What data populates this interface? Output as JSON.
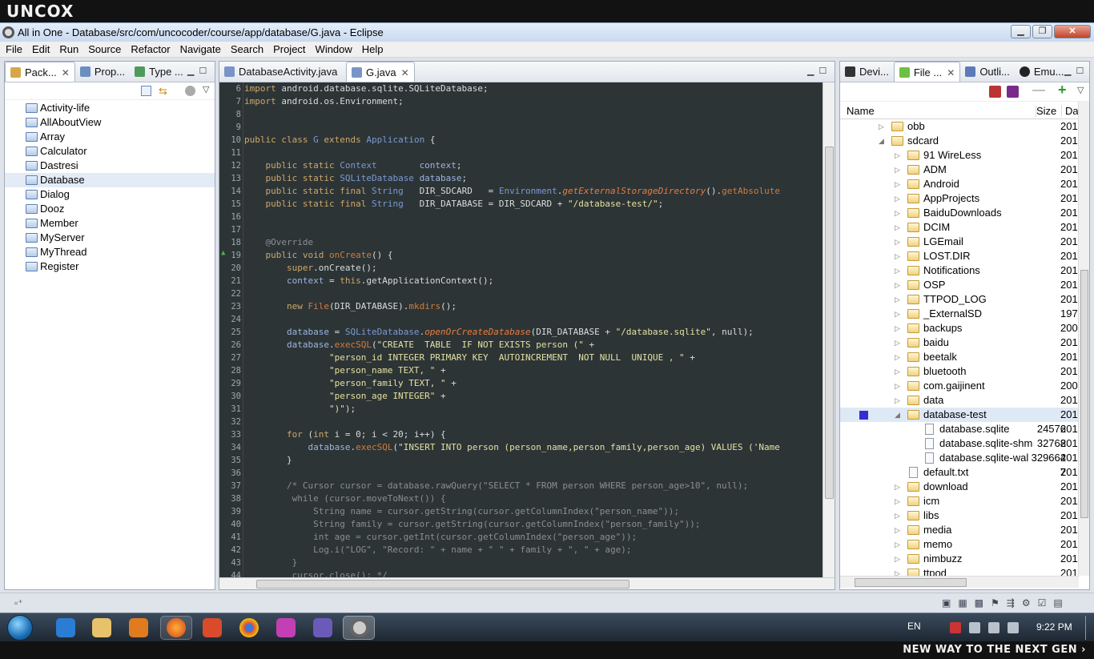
{
  "brand": "UNCOX",
  "tagline": "NEW WAY TO THE NEXT GEN ›",
  "window": {
    "title": "All in One - Database/src/com/uncocoder/course/app/database/G.java - Eclipse"
  },
  "menu": [
    "File",
    "Edit",
    "Run",
    "Source",
    "Refactor",
    "Navigate",
    "Search",
    "Project",
    "Window",
    "Help"
  ],
  "left_tabs": [
    "Pack...",
    "Prop...",
    "Type ..."
  ],
  "projects": [
    "Activity-life",
    "AllAboutView",
    "Array",
    "Calculator",
    "Dastresi",
    "Database",
    "Dialog",
    "Dooz",
    "Member",
    "MyServer",
    "MyThread",
    "Register"
  ],
  "selected_project": "Database",
  "editor_tabs": [
    "DatabaseActivity.java",
    "G.java"
  ],
  "line_numbers": [
    "6",
    "7",
    "8",
    "9",
    "10",
    "11",
    "12",
    "13",
    "14",
    "15",
    "16",
    "17",
    "18",
    "19",
    "20",
    "21",
    "22",
    "23",
    "24",
    "25",
    "26",
    "27",
    "28",
    "29",
    "30",
    "31",
    "32",
    "33",
    "34",
    "35",
    "36",
    "37",
    "38",
    "39",
    "40",
    "41",
    "42",
    "43",
    "44"
  ],
  "right_tabs": [
    "Devi...",
    "File ...",
    "Outli...",
    "Emu..."
  ],
  "file_columns": {
    "name": "Name",
    "size": "Size",
    "date": "Dat"
  },
  "files": [
    {
      "name": "obb",
      "level": 1,
      "type": "folder",
      "expanded": false,
      "size": "",
      "date": "201"
    },
    {
      "name": "sdcard",
      "level": 1,
      "type": "folder",
      "expanded": true,
      "size": "",
      "date": "201"
    },
    {
      "name": "91 WireLess",
      "level": 2,
      "type": "folder",
      "expanded": false,
      "size": "",
      "date": "201"
    },
    {
      "name": "ADM",
      "level": 2,
      "type": "folder",
      "expanded": false,
      "size": "",
      "date": "201"
    },
    {
      "name": "Android",
      "level": 2,
      "type": "folder",
      "expanded": false,
      "size": "",
      "date": "201"
    },
    {
      "name": "AppProjects",
      "level": 2,
      "type": "folder",
      "expanded": false,
      "size": "",
      "date": "201"
    },
    {
      "name": "BaiduDownloads",
      "level": 2,
      "type": "folder",
      "expanded": false,
      "size": "",
      "date": "201"
    },
    {
      "name": "DCIM",
      "level": 2,
      "type": "folder",
      "expanded": false,
      "size": "",
      "date": "201"
    },
    {
      "name": "LGEmail",
      "level": 2,
      "type": "folder",
      "expanded": false,
      "size": "",
      "date": "201"
    },
    {
      "name": "LOST.DIR",
      "level": 2,
      "type": "folder",
      "expanded": false,
      "size": "",
      "date": "201"
    },
    {
      "name": "Notifications",
      "level": 2,
      "type": "folder",
      "expanded": false,
      "size": "",
      "date": "201"
    },
    {
      "name": "OSP",
      "level": 2,
      "type": "folder",
      "expanded": false,
      "size": "",
      "date": "201"
    },
    {
      "name": "TTPOD_LOG",
      "level": 2,
      "type": "folder",
      "expanded": false,
      "size": "",
      "date": "201"
    },
    {
      "name": "_ExternalSD",
      "level": 2,
      "type": "folder",
      "expanded": false,
      "size": "",
      "date": "197"
    },
    {
      "name": "backups",
      "level": 2,
      "type": "folder",
      "expanded": false,
      "size": "",
      "date": "200"
    },
    {
      "name": "baidu",
      "level": 2,
      "type": "folder",
      "expanded": false,
      "size": "",
      "date": "201"
    },
    {
      "name": "beetalk",
      "level": 2,
      "type": "folder",
      "expanded": false,
      "size": "",
      "date": "201"
    },
    {
      "name": "bluetooth",
      "level": 2,
      "type": "folder",
      "expanded": false,
      "size": "",
      "date": "201"
    },
    {
      "name": "com.gaijinent",
      "level": 2,
      "type": "folder",
      "expanded": false,
      "size": "",
      "date": "200"
    },
    {
      "name": "data",
      "level": 2,
      "type": "folder",
      "expanded": false,
      "size": "",
      "date": "201"
    },
    {
      "name": "database-test",
      "level": 2,
      "type": "folder",
      "expanded": true,
      "size": "",
      "date": "201",
      "selected": true
    },
    {
      "name": "database.sqlite",
      "level": 3,
      "type": "file",
      "size": "24576",
      "date": "201"
    },
    {
      "name": "database.sqlite-shm",
      "level": 3,
      "type": "file",
      "size": "32768",
      "date": "201"
    },
    {
      "name": "database.sqlite-wal",
      "level": 3,
      "type": "file",
      "size": "329664",
      "date": "201"
    },
    {
      "name": "default.txt",
      "level": 2,
      "type": "file",
      "size": "7",
      "date": "201"
    },
    {
      "name": "download",
      "level": 2,
      "type": "folder",
      "expanded": false,
      "size": "",
      "date": "201"
    },
    {
      "name": "icm",
      "level": 2,
      "type": "folder",
      "expanded": false,
      "size": "",
      "date": "201"
    },
    {
      "name": "libs",
      "level": 2,
      "type": "folder",
      "expanded": false,
      "size": "",
      "date": "201"
    },
    {
      "name": "media",
      "level": 2,
      "type": "folder",
      "expanded": false,
      "size": "",
      "date": "201"
    },
    {
      "name": "memo",
      "level": 2,
      "type": "folder",
      "expanded": false,
      "size": "",
      "date": "201"
    },
    {
      "name": "nimbuzz",
      "level": 2,
      "type": "folder",
      "expanded": false,
      "size": "",
      "date": "201"
    },
    {
      "name": "ttpod",
      "level": 2,
      "type": "folder",
      "expanded": false,
      "size": "",
      "date": "201"
    }
  ],
  "taskbar": {
    "lang": "EN",
    "clock": "9:22 PM"
  }
}
